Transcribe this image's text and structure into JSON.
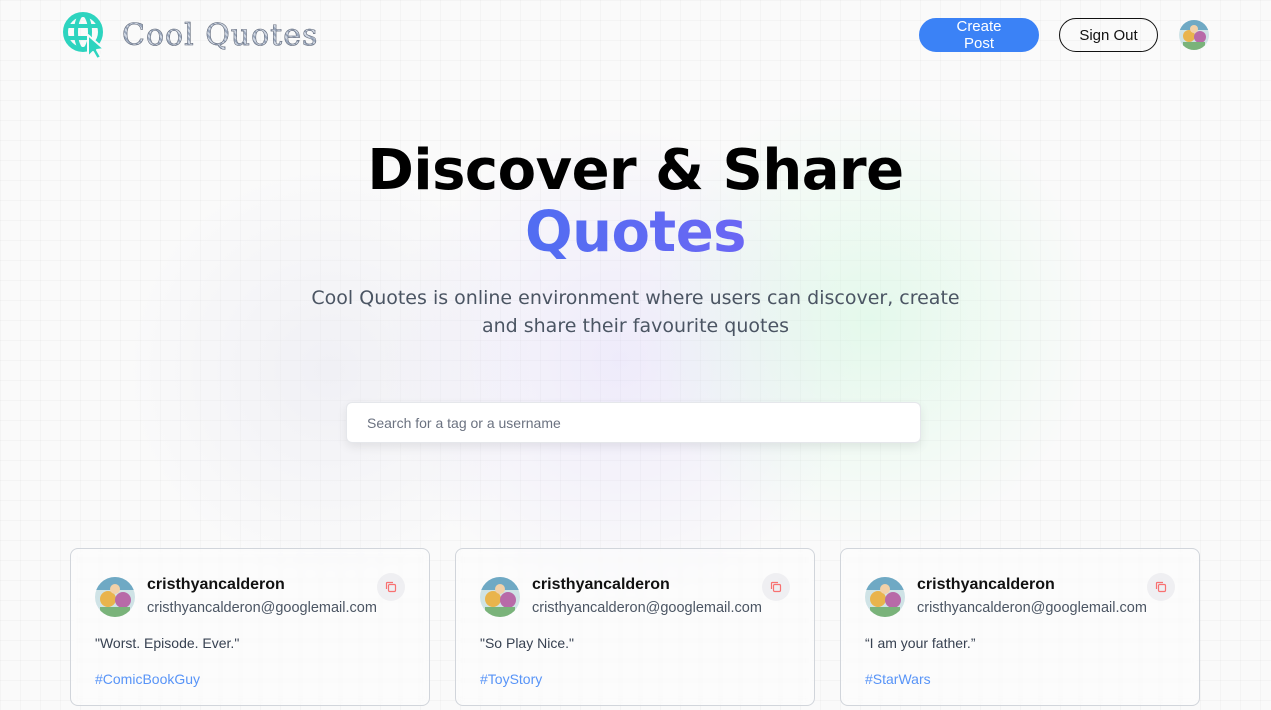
{
  "nav": {
    "brand_name": "Cool Quotes",
    "create_post_label": "Create Post",
    "sign_out_label": "Sign Out"
  },
  "hero": {
    "title_line1": "Discover & Share",
    "title_line2": "Quotes",
    "description": "Cool Quotes is online environment where users can discover, create and share their favourite quotes"
  },
  "search": {
    "placeholder": "Search for a tag or a username",
    "value": ""
  },
  "cards": [
    {
      "username": "cristhyancalderon",
      "email": "cristhyancalderon@googlemail.com",
      "quote": "\"Worst. Episode. Ever.\"",
      "tag": "#ComicBookGuy"
    },
    {
      "username": "cristhyancalderon",
      "email": "cristhyancalderon@googlemail.com",
      "quote": "\"So Play Nice.\"",
      "tag": "#ToyStory"
    },
    {
      "username": "cristhyancalderon",
      "email": "cristhyancalderon@googlemail.com",
      "quote": "“I am your father.”",
      "tag": "#StarWars"
    }
  ],
  "icons": {
    "logo": "globe-cursor-icon",
    "copy": "copy-icon",
    "avatar": "avatar"
  },
  "colors": {
    "accent": "#3b82f6",
    "gradient_start": "#3b82f6",
    "gradient_end": "#a855f7",
    "logo": "#2dd4bf",
    "copy_icon": "#f87171"
  }
}
